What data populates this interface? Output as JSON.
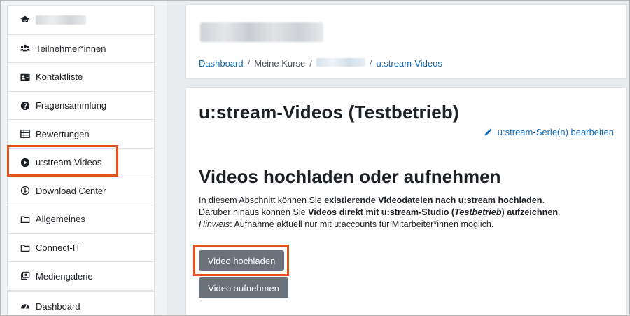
{
  "sidebar": {
    "items": [
      {
        "name": "course-home",
        "label": ""
      },
      {
        "name": "teilnehmer",
        "label": "Teilnehmer*innen"
      },
      {
        "name": "kontaktliste",
        "label": "Kontaktliste"
      },
      {
        "name": "fragensammlung",
        "label": "Fragensammlung"
      },
      {
        "name": "bewertungen",
        "label": "Bewertungen"
      },
      {
        "name": "ustream-videos",
        "label": "u:stream-Videos"
      },
      {
        "name": "download-center",
        "label": "Download Center"
      },
      {
        "name": "allgemeines",
        "label": "Allgemeines"
      },
      {
        "name": "connect-it",
        "label": "Connect-IT"
      },
      {
        "name": "mediengalerie",
        "label": "Mediengalerie"
      }
    ],
    "dashboard": {
      "label": "Dashboard"
    }
  },
  "breadcrumb": {
    "dashboard": "Dashboard",
    "separator": "/",
    "courses": "Meine Kurse",
    "current": "u:stream-Videos"
  },
  "main": {
    "title": "u:stream-Videos (Testbetrieb)",
    "edit_link": "u:stream-Serie(n) bearbeiten",
    "section_title": "Videos hochladen oder aufnehmen",
    "desc": {
      "l1_a": "In diesem Abschnitt können Sie ",
      "l1_b": "existierende Videodateien nach u:stream hochladen",
      "l1_c": ".",
      "l2_a": "Darüber hinaus können Sie ",
      "l2_b": "Videos direkt mit u:stream-Studio (",
      "l2_bi": "Testbetrieb",
      "l2_c": ") aufzeichnen",
      "l2_d": ".",
      "l3_a": "Hinweis",
      "l3_b": ": Aufnahme aktuell nur mit u:accounts für Mitarbeiter*innen möglich."
    },
    "upload_button": "Video hochladen",
    "record_button": "Video aufnehmen"
  },
  "colors": {
    "link": "#0f6cbf",
    "button": "#6a737b",
    "highlight": "#e2531c"
  }
}
